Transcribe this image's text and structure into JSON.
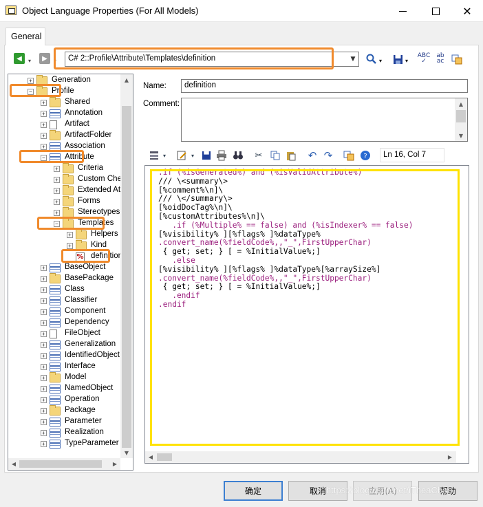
{
  "window": {
    "title": "Object Language Properties (For All Models)"
  },
  "tabs": [
    {
      "label": "General"
    }
  ],
  "toolbar": {
    "path": "C# 2::Profile\\Attribute\\Templates\\definition"
  },
  "tree": {
    "items": [
      {
        "label": "Generation",
        "depth": 1,
        "icon": "folder-icon",
        "expander": "+"
      },
      {
        "label": "Profile",
        "depth": 1,
        "icon": "folder-icon",
        "expander": "-"
      },
      {
        "label": "Shared",
        "depth": 2,
        "icon": "folder-icon",
        "expander": "+"
      },
      {
        "label": "Annotation",
        "depth": 2,
        "icon": "class-icon",
        "expander": "+"
      },
      {
        "label": "Artifact",
        "depth": 2,
        "icon": "file-icon",
        "expander": "+"
      },
      {
        "label": "ArtifactFolder",
        "depth": 2,
        "icon": "folder-icon",
        "expander": "+"
      },
      {
        "label": "Association",
        "depth": 2,
        "icon": "association-icon",
        "expander": "+"
      },
      {
        "label": "Attribute",
        "depth": 2,
        "icon": "class-icon",
        "expander": "-"
      },
      {
        "label": "Criteria",
        "depth": 3,
        "icon": "folder-icon",
        "expander": "+"
      },
      {
        "label": "Custom Checks",
        "depth": 3,
        "icon": "folder-icon",
        "expander": "+"
      },
      {
        "label": "Extended Attribute",
        "depth": 3,
        "icon": "folder-icon",
        "expander": "+"
      },
      {
        "label": "Forms",
        "depth": 3,
        "icon": "folder-icon",
        "expander": "+"
      },
      {
        "label": "Stereotypes",
        "depth": 3,
        "icon": "folder-icon",
        "expander": "+"
      },
      {
        "label": "Templates",
        "depth": 3,
        "icon": "folder-icon",
        "expander": "-"
      },
      {
        "label": "Helpers",
        "depth": 4,
        "icon": "folder-icon",
        "expander": "+"
      },
      {
        "label": "Kind",
        "depth": 4,
        "icon": "folder-icon",
        "expander": "+"
      },
      {
        "label": "definition",
        "depth": 4,
        "icon": "template-icon",
        "expander": ""
      },
      {
        "label": "BaseObject",
        "depth": 2,
        "icon": "class-icon",
        "expander": "+"
      },
      {
        "label": "BasePackage",
        "depth": 2,
        "icon": "folder-icon",
        "expander": "+"
      },
      {
        "label": "Class",
        "depth": 2,
        "icon": "class-icon",
        "expander": "+"
      },
      {
        "label": "Classifier",
        "depth": 2,
        "icon": "class-icon",
        "expander": "+"
      },
      {
        "label": "Component",
        "depth": 2,
        "icon": "component-icon",
        "expander": "+"
      },
      {
        "label": "Dependency",
        "depth": 2,
        "icon": "dependency-icon",
        "expander": "+"
      },
      {
        "label": "FileObject",
        "depth": 2,
        "icon": "file-icon",
        "expander": "+"
      },
      {
        "label": "Generalization",
        "depth": 2,
        "icon": "generalization-icon",
        "expander": "+"
      },
      {
        "label": "IdentifiedObject",
        "depth": 2,
        "icon": "class-icon",
        "expander": "+"
      },
      {
        "label": "Interface",
        "depth": 2,
        "icon": "interface-icon",
        "expander": "+"
      },
      {
        "label": "Model",
        "depth": 2,
        "icon": "model-icon",
        "expander": "+"
      },
      {
        "label": "NamedObject",
        "depth": 2,
        "icon": "class-icon",
        "expander": "+"
      },
      {
        "label": "Operation",
        "depth": 2,
        "icon": "class-icon",
        "expander": "+"
      },
      {
        "label": "Package",
        "depth": 2,
        "icon": "folder-icon",
        "expander": "+"
      },
      {
        "label": "Parameter",
        "depth": 2,
        "icon": "class-icon",
        "expander": "+"
      },
      {
        "label": "Realization",
        "depth": 2,
        "icon": "realization-icon",
        "expander": "+"
      },
      {
        "label": "TypeParameter",
        "depth": 2,
        "icon": "class-icon",
        "expander": "+"
      }
    ]
  },
  "form": {
    "name_label": "Name:",
    "name_value": "definition",
    "comment_label": "Comment:",
    "comment_value": ""
  },
  "editor": {
    "position": "Ln 16, Col 7",
    "lines": [
      {
        "text": ".if (%isGenerated%) and (%isValidAttribute%)",
        "kind": "dir"
      },
      {
        "text": "/// \\<summary\\>",
        "kind": "txt"
      },
      {
        "text": "[%comment%\\n]\\",
        "kind": "txt"
      },
      {
        "text": "/// \\</summary\\>",
        "kind": "txt"
      },
      {
        "text": "[%oidDocTag%\\n]\\",
        "kind": "txt"
      },
      {
        "text": "[%customAttributes%\\n]\\",
        "kind": "txt"
      },
      {
        "text": "   .if (%Multiple% == false) and (%isIndexer% == false)",
        "kind": "dir"
      },
      {
        "text": "[%visibility% ][%flags% ]%dataType%",
        "kind": "txt"
      },
      {
        "text": ".convert_name(%fieldCode%,,\"_\",FirstUpperChar)",
        "kind": "dir"
      },
      {
        "text": " { get; set; } [ = %InitialValue%;]",
        "kind": "txt"
      },
      {
        "text": "   .else",
        "kind": "dir"
      },
      {
        "text": "[%visibility% ][%flags% ]%dataType%[%arraySize%]",
        "kind": "txt"
      },
      {
        "text": ".convert_name(%fieldCode%,,\"_\",FirstUpperChar)",
        "kind": "dir"
      },
      {
        "text": " { get; set; } [ = %InitialValue%;]",
        "kind": "txt"
      },
      {
        "text": "   .endif",
        "kind": "dir"
      },
      {
        "text": ".endif",
        "kind": "dir"
      }
    ]
  },
  "buttons": {
    "ok": "确定",
    "cancel": "取消",
    "apply": "应用(A)",
    "help": "帮助"
  },
  "watermark": "https://blog.csdn.net/iTheaChan",
  "colors": {
    "highlight_orange": "#f08a2c",
    "highlight_yellow": "#ffe200",
    "directive": "#9b1f7e"
  }
}
